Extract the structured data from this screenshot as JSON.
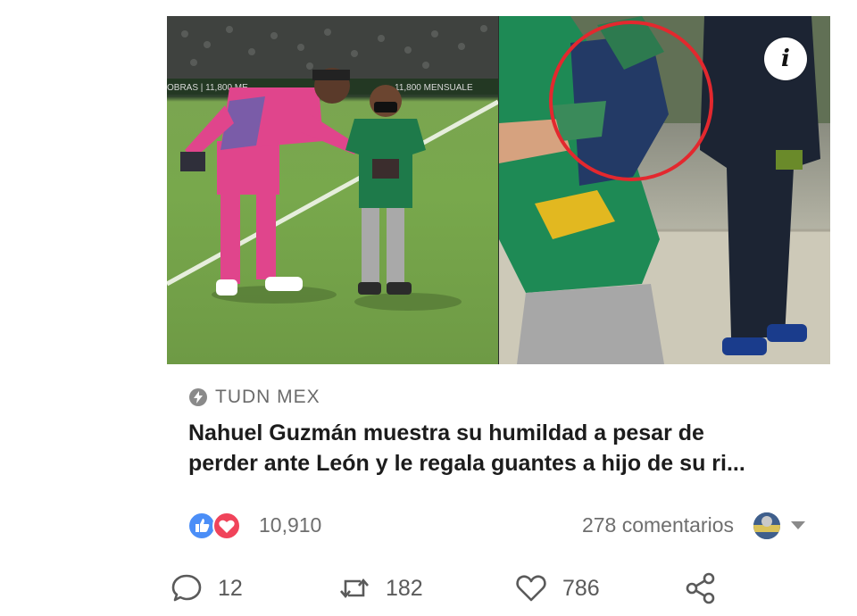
{
  "post": {
    "info_icon": "info-icon",
    "source_icon": "bolt-circle-icon",
    "source_name": "TUDN MEX",
    "headline_line1": "Nahuel Guzmán muestra su humildad a pesar de",
    "headline_line2": "perder ante León y le regala guantes a hijo de su ri...",
    "stadium_banner": "11,800 MENSUALE",
    "stadium_banner_left": "OBRAS | 11,800 ME"
  },
  "reactions": {
    "icons": [
      "like-icon",
      "love-icon"
    ],
    "count": "10,910",
    "comments": "278 comentarios"
  },
  "actions": {
    "reply": "12",
    "retweet": "182",
    "like": "786",
    "share_icon": "share-icon"
  },
  "colors": {
    "like_blue": "#4b8ef7",
    "love_red": "#f0435a",
    "highlight_circle": "#e3282e",
    "keeper_pink": "#e0458c",
    "leon_green": "#1e7a4a"
  }
}
